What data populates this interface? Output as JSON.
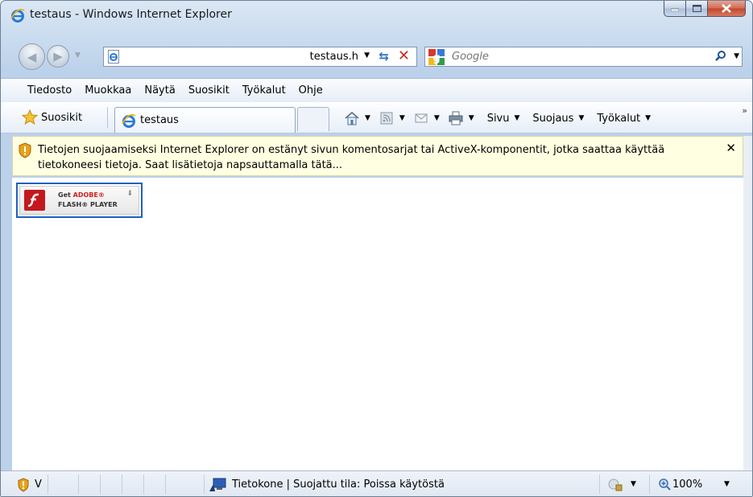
{
  "window": {
    "title": "testaus - Windows Internet Explorer"
  },
  "address": {
    "url": "testaus.h"
  },
  "search": {
    "placeholder": "Google"
  },
  "menu": {
    "items": [
      "Tiedosto",
      "Muokkaa",
      "Näytä",
      "Suosikit",
      "Työkalut",
      "Ohje"
    ]
  },
  "favorites": {
    "label": "Suosikit"
  },
  "tab": {
    "label": "testaus"
  },
  "commands": {
    "page": "Sivu",
    "safety": "Suojaus",
    "tools": "Työkalut"
  },
  "infobar": {
    "message": "Tietojen suojaamiseksi Internet Explorer on estänyt sivun komentosarjat tai ActiveX-komponentit, jotka saattaa käyttää tietokoneesi tietoja. Saat lisätietoja napsauttamalla tätä..."
  },
  "flash": {
    "get": "Get",
    "adobe": "ADOBE®",
    "product": "FLASH® PLAYER"
  },
  "status": {
    "left_text": "V",
    "zone": "Tietokone | Suojattu tila: Poissa käytöstä",
    "zoom": "100%"
  }
}
